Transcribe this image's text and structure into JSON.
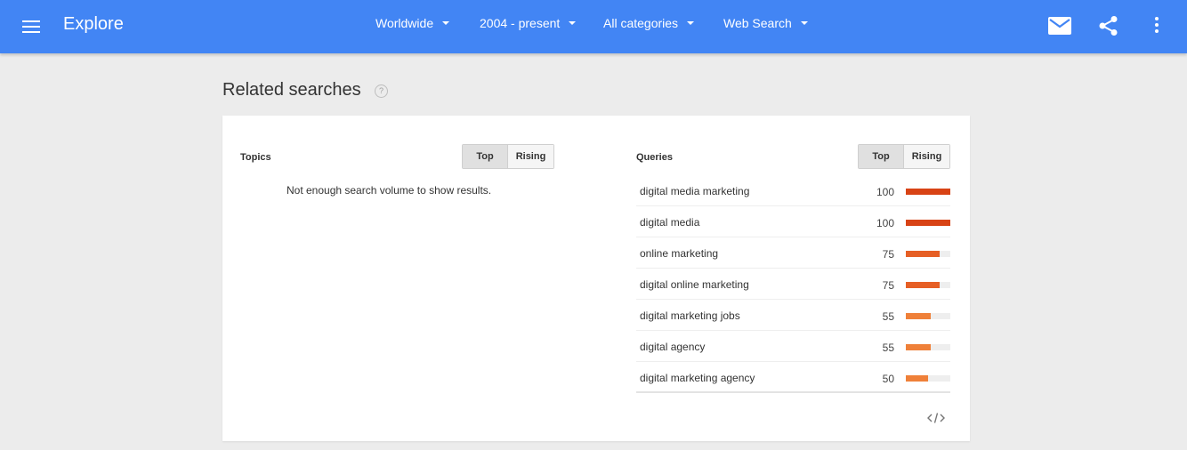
{
  "header": {
    "title": "Explore",
    "filters": [
      {
        "label": "Worldwide"
      },
      {
        "label": "2004 - present"
      },
      {
        "label": "All categories"
      },
      {
        "label": "Web Search"
      }
    ],
    "icons": [
      "menu-icon",
      "mail-icon",
      "share-icon",
      "more-vert-icon"
    ]
  },
  "section": {
    "title": "Related searches",
    "help_glyph": "?"
  },
  "topics": {
    "label": "Topics",
    "top_label": "Top",
    "rising_label": "Rising",
    "empty_message": "Not enough search volume to show results."
  },
  "queries": {
    "label": "Queries",
    "top_label": "Top",
    "rising_label": "Rising",
    "items": [
      {
        "name": "digital media marketing",
        "value": "100"
      },
      {
        "name": "digital media",
        "value": "100"
      },
      {
        "name": "online marketing",
        "value": "75"
      },
      {
        "name": "digital online marketing",
        "value": "75"
      },
      {
        "name": "digital marketing jobs",
        "value": "55"
      },
      {
        "name": "digital agency",
        "value": "55"
      },
      {
        "name": "digital marketing agency",
        "value": "50"
      }
    ]
  },
  "colors": {
    "header_blue": "#4285f4",
    "bar_100": "#d84315",
    "bar_75": "#e65f25",
    "bar_55": "#ef8039"
  }
}
